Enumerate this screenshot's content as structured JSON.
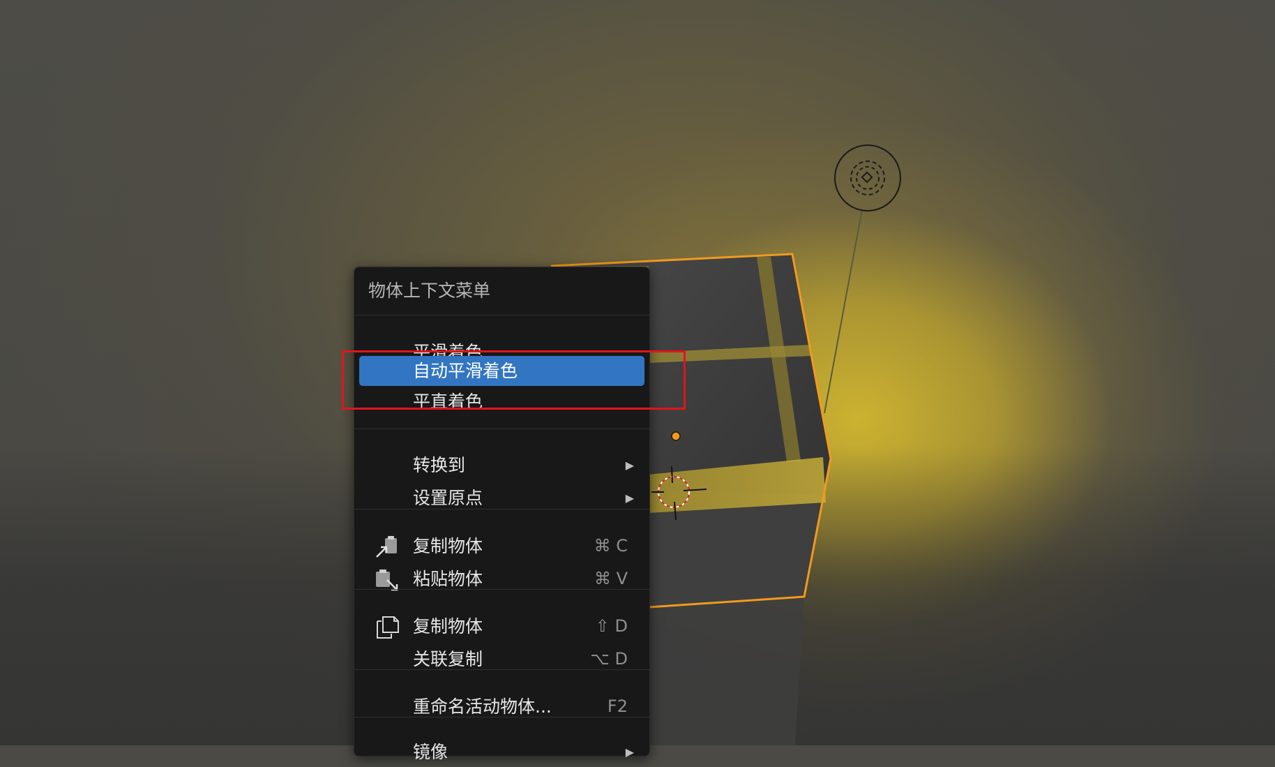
{
  "menu": {
    "title": "物体上下文菜单",
    "items": [
      {
        "label": "平滑着色"
      },
      {
        "label": "自动平滑着色",
        "active": true
      },
      {
        "label": "平直着色"
      },
      {
        "label": "转换到",
        "arrow": "▶"
      },
      {
        "label": "设置原点",
        "arrow": "▶"
      },
      {
        "label": "复制物体",
        "shortcut": "⌘ C",
        "icon": "copy-object-icon"
      },
      {
        "label": "粘贴物体",
        "shortcut": "⌘ V",
        "icon": "paste-object-icon"
      },
      {
        "label": "复制物体",
        "shortcut": "⇧ D",
        "icon": "duplicate-icon"
      },
      {
        "label": "关联复制",
        "shortcut": "⌥ D"
      },
      {
        "label": "重命名活动物体...",
        "shortcut": "F2"
      },
      {
        "label": "镜像",
        "arrow": "▶"
      }
    ]
  },
  "colors": {
    "menu_bg": "#181818",
    "active_item": "#3275c2",
    "selection_outline": "#f29a1e",
    "annotation_box": "#e0141f",
    "light_color": "#c7ae34"
  },
  "viewport": {
    "objects": [
      "cube",
      "area-light",
      "3d-cursor",
      "object-origin"
    ]
  }
}
